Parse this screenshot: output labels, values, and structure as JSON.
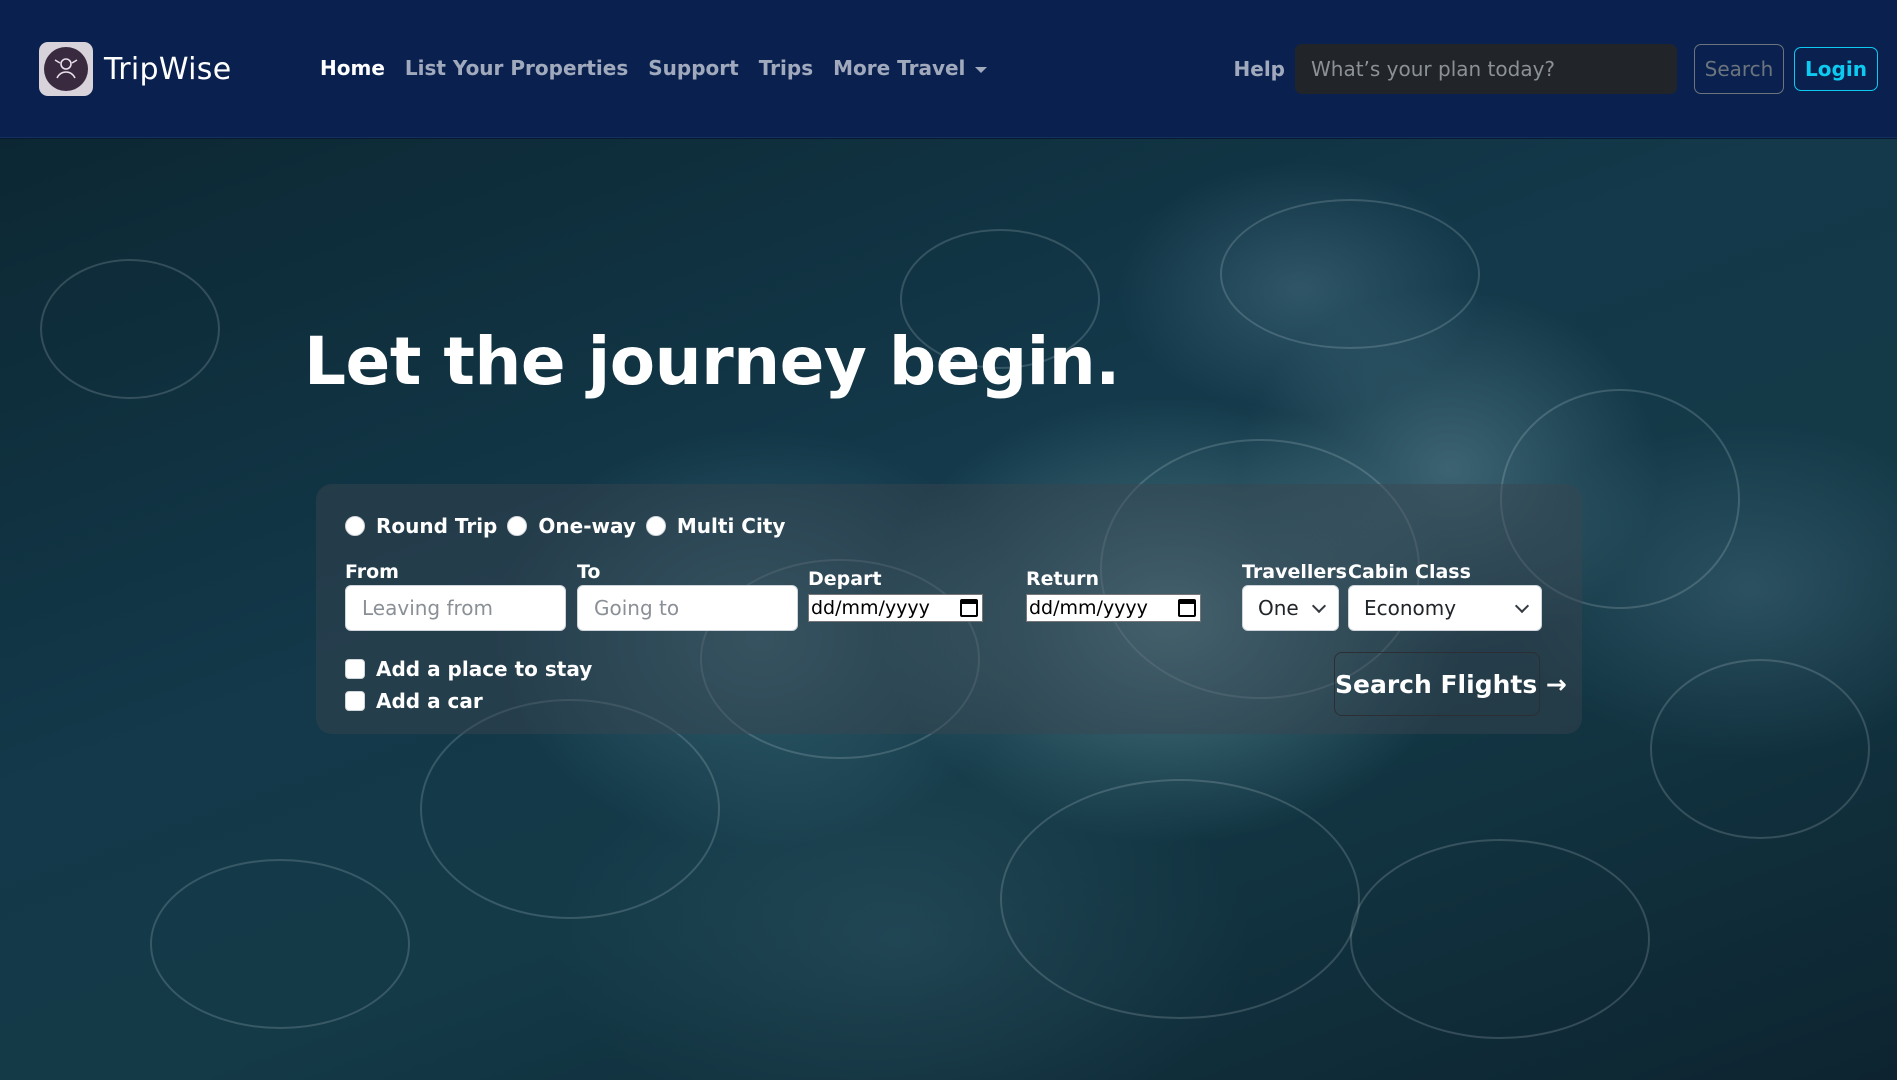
{
  "brand": {
    "name": "TripWise"
  },
  "nav": {
    "links": [
      "Home",
      "List Your Properties",
      "Support",
      "Trips",
      "More Travel"
    ],
    "help": "Help",
    "search_placeholder": "What’s your plan today?",
    "search_button": "Search",
    "login_button": "Login"
  },
  "hero": {
    "title": "Let the journey begin."
  },
  "booking": {
    "trip_types": [
      "Round Trip",
      "One-way",
      "Multi City"
    ],
    "from": {
      "label": "From",
      "placeholder": "Leaving from"
    },
    "to": {
      "label": "To",
      "placeholder": "Going to"
    },
    "depart": {
      "label": "Depart",
      "value": "dd/mm/yyyy"
    },
    "return": {
      "label": "Return",
      "value": "dd/mm/yyyy"
    },
    "travellers": {
      "label": "Travellers",
      "value": "One"
    },
    "cabin_class": {
      "label": "Cabin Class",
      "value": "Economy"
    },
    "addons": [
      "Add a place to stay",
      "Add a car"
    ],
    "submit": "Search Flights →"
  },
  "colors": {
    "navbar_bg": "#0a2150",
    "login_accent": "#0dcaf0",
    "search_btn": "#6c757d"
  }
}
